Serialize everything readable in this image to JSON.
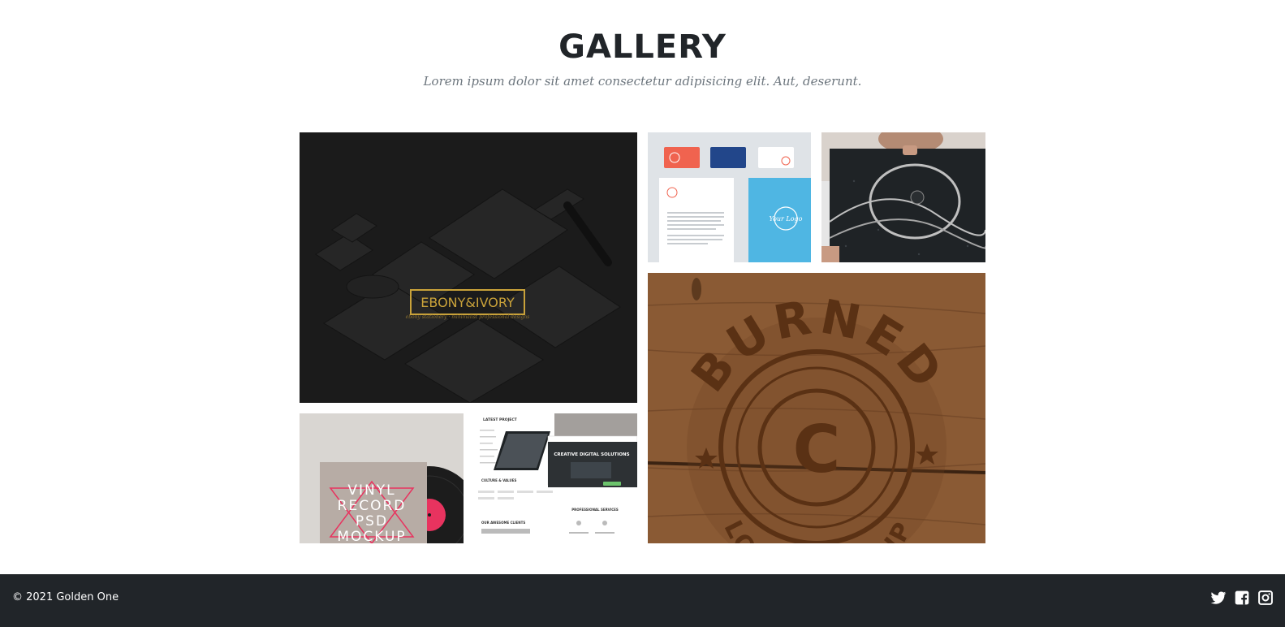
{
  "section": {
    "title": "GALLERY",
    "subtitle": "Lorem ipsum dolor sit amet consectetur adipisicing elit. Aut, deserunt."
  },
  "gallery": {
    "items": [
      {
        "id": "ebony-ivory",
        "brand": "EBONY&IVORY",
        "tagline": "ebony stationery · minimalist professional designs"
      },
      {
        "id": "business-cards",
        "logo_text": "Your Logo"
      },
      {
        "id": "poster"
      },
      {
        "id": "burned-logo",
        "text": "BURNED",
        "bottom_text": "LOGO MOCK-UP",
        "letter": "C"
      },
      {
        "id": "vinyl-mockup",
        "lines": [
          "VINYL",
          "RECORD",
          "PSD",
          "MOCKUP"
        ]
      },
      {
        "id": "web-mockup",
        "heading": "LATEST PROJECT",
        "hero": "CREATIVE DIGITAL SOLUTIONS",
        "section1": "CULTURE & VALUES",
        "section2": "PROFESSIONAL SERVICES",
        "section3": "OUR AWESOME CLIENTS"
      }
    ]
  },
  "footer": {
    "copyright": "© 2021 Golden One",
    "social": [
      {
        "icon": "twitter-icon"
      },
      {
        "icon": "facebook-icon"
      },
      {
        "icon": "instagram-icon"
      }
    ]
  },
  "colors": {
    "heading": "#212529",
    "subtitle": "#6c757d",
    "footer_bg": "#212529",
    "footer_text": "#ffffff",
    "gold": "#c9a23a",
    "wood": "#8a5a34",
    "accent_pink": "#e8335f",
    "accent_blue": "#4fb6e3"
  }
}
